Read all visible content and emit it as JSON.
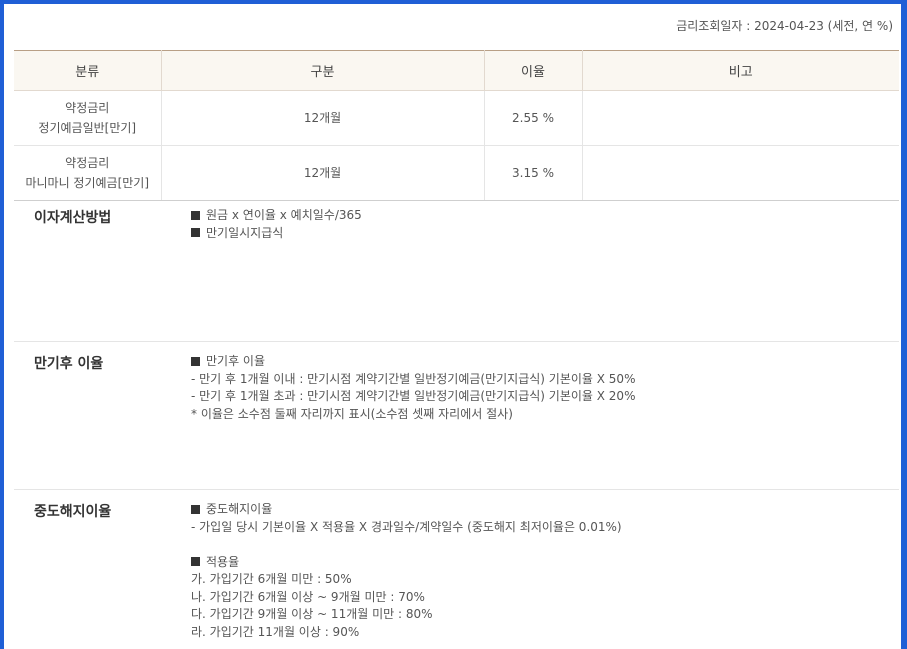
{
  "query_date": "금리조회일자 : 2024-04-23 (세전, 연 %)",
  "table": {
    "headers": [
      "분류",
      "구분",
      "이율",
      "비고"
    ],
    "rows": [
      {
        "category_1": "약정금리",
        "category_2": "정기예금일반[만기]",
        "term": "12개월",
        "rate": "2.55 %",
        "note": ""
      },
      {
        "category_1": "약정금리",
        "category_2": "마니마니 정기예금[만기]",
        "term": "12개월",
        "rate": "3.15 %",
        "note": ""
      }
    ]
  },
  "sections": {
    "interest_calc": {
      "title": "이자계산방법",
      "lines": [
        "원금 x 연이율 x 예치일수/365",
        "만기일시지급식"
      ]
    },
    "after_maturity": {
      "title": "만기후 이율",
      "heading": "만기후 이율",
      "lines": [
        "- 만기 후 1개월 이내 : 만기시점 계약기간별 일반정기예금(만기지급식) 기본이율 X 50%",
        "- 만기 후 1개월 초과 : 만기시점 계약기간별 일반정기예금(만기지급식) 기본이율 X 20%",
        "* 이율은 소수점 둘째 자리까지 표시(소수점 셋째 자리에서 절사)"
      ]
    },
    "early_termination": {
      "title": "중도해지이율",
      "heading": "중도해지이율",
      "formula": "- 가입일 당시 기본이율 X 적용율 X 경과일수/계약일수 (중도해지 최저이율은 0.01%)",
      "rates_heading": "적용율",
      "rates": [
        "가. 가입기간 6개월 미만 : 50%",
        "나. 가입기간 6개월 이상 ~ 9개월 미만 : 70%",
        "다. 가입기간 9개월 이상 ~ 11개월 미만 : 80%",
        "라. 가입기간 11개월 이상 : 90%"
      ]
    }
  },
  "colors": {
    "frame_border": "#1f5fd6",
    "header_bg": "#faf7f1",
    "table_top_border": "#b89f86"
  }
}
